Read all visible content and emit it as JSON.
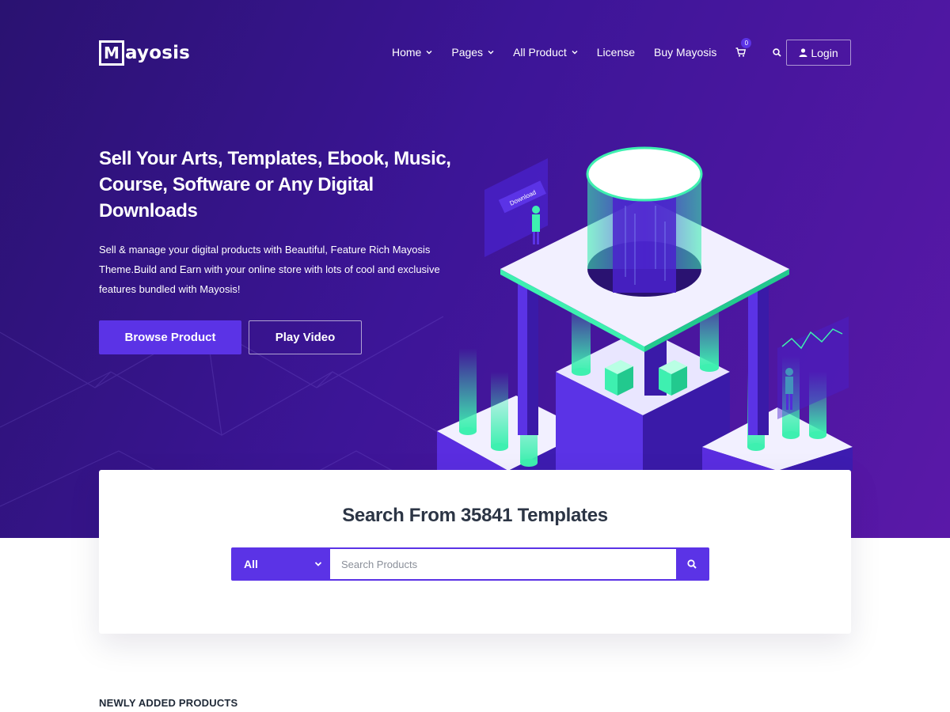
{
  "brand": {
    "logo_letter": "M",
    "logo_rest": "ayosis"
  },
  "nav": {
    "items": [
      {
        "label": "Home",
        "dropdown": true
      },
      {
        "label": "Pages",
        "dropdown": true
      },
      {
        "label": "All Product",
        "dropdown": true
      },
      {
        "label": "License",
        "dropdown": false
      },
      {
        "label": "Buy Mayosis",
        "dropdown": false
      }
    ],
    "cart_count": "0",
    "login_label": "Login",
    "icons": [
      "cart-icon",
      "search-icon",
      "user-icon"
    ]
  },
  "hero": {
    "headline": "Sell Your Arts, Templates, Ebook, Music, Course, Software or Any Digital Downloads",
    "subtext": "Sell & manage your digital products with Beautiful, Feature Rich Mayosis Theme.Build and Earn with your online store with lots of cool and exclusive features bundled with Mayosis!",
    "primary_button": "Browse Product",
    "secondary_button": "Play Video",
    "illustration_sign": "Download"
  },
  "search": {
    "title": "Search From 35841 Templates",
    "category_selected": "All",
    "placeholder": "Search Products"
  },
  "section": {
    "title": "NEWLY ADDED PRODUCTS"
  },
  "colors": {
    "hero_bg_start": "#2a1271",
    "hero_bg_end": "#5a18a8",
    "accent": "#5b33e6",
    "mint": "#3ef0b0",
    "text_dark": "#2c3545"
  }
}
